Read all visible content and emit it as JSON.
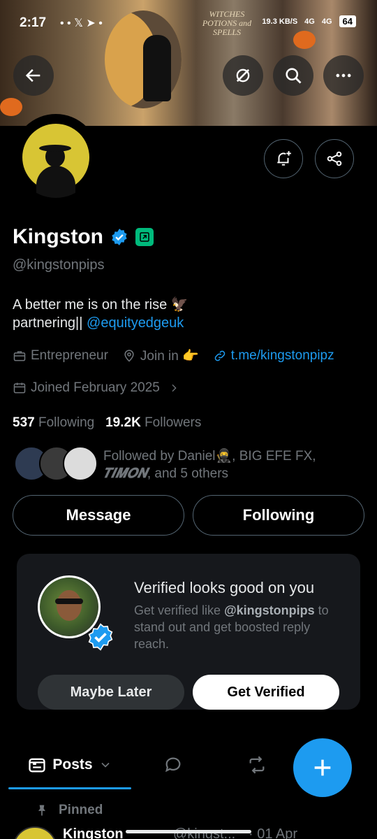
{
  "status_bar": {
    "time": "2:17",
    "icons": "• • 𝕏 ➤ •",
    "speed": "19.3 KB/S",
    "net1": "4G",
    "net2": "4G",
    "battery": "64"
  },
  "banner": {
    "book_text": "WITCHES POTIONS and SPELLS"
  },
  "profile": {
    "name": "Kingston",
    "handle": "@kingstonpips",
    "bio_line1": "A better me is on the rise 🦅",
    "bio_line2_prefix": "partnering|| ",
    "bio_line2_link": "@equityedgeuk",
    "category": "Entrepreneur",
    "location": "Join in 👉",
    "website": "t.me/kingstonpipz",
    "joined": "Joined February 2025",
    "following_count": "537",
    "following_label": "Following",
    "followers_count": "19.2K",
    "followers_label": "Followers",
    "followed_by_prefix": "Followed by Daniel🥷, BIG EFE FX,",
    "followed_by_italic": "𝑻𝑰𝑴𝑶𝑵",
    "followed_by_suffix": ", and 5 others"
  },
  "actions": {
    "message": "Message",
    "following": "Following"
  },
  "verified_card": {
    "title": "Verified looks good on you",
    "desc_prefix": "Get verified like ",
    "desc_handle": "@kingstonpips",
    "desc_suffix": " to stand out and get boosted reply reach.",
    "maybe_later": "Maybe Later",
    "get_verified": "Get Verified"
  },
  "tabs": {
    "posts": "Posts"
  },
  "pinned": {
    "label": "Pinned",
    "name": "Kingston",
    "handle": "@kingst...",
    "date": "· 01 Apr"
  },
  "colors": {
    "accent": "#1d9bf0",
    "verified_green": "#00ba7c",
    "muted": "#71767b"
  }
}
